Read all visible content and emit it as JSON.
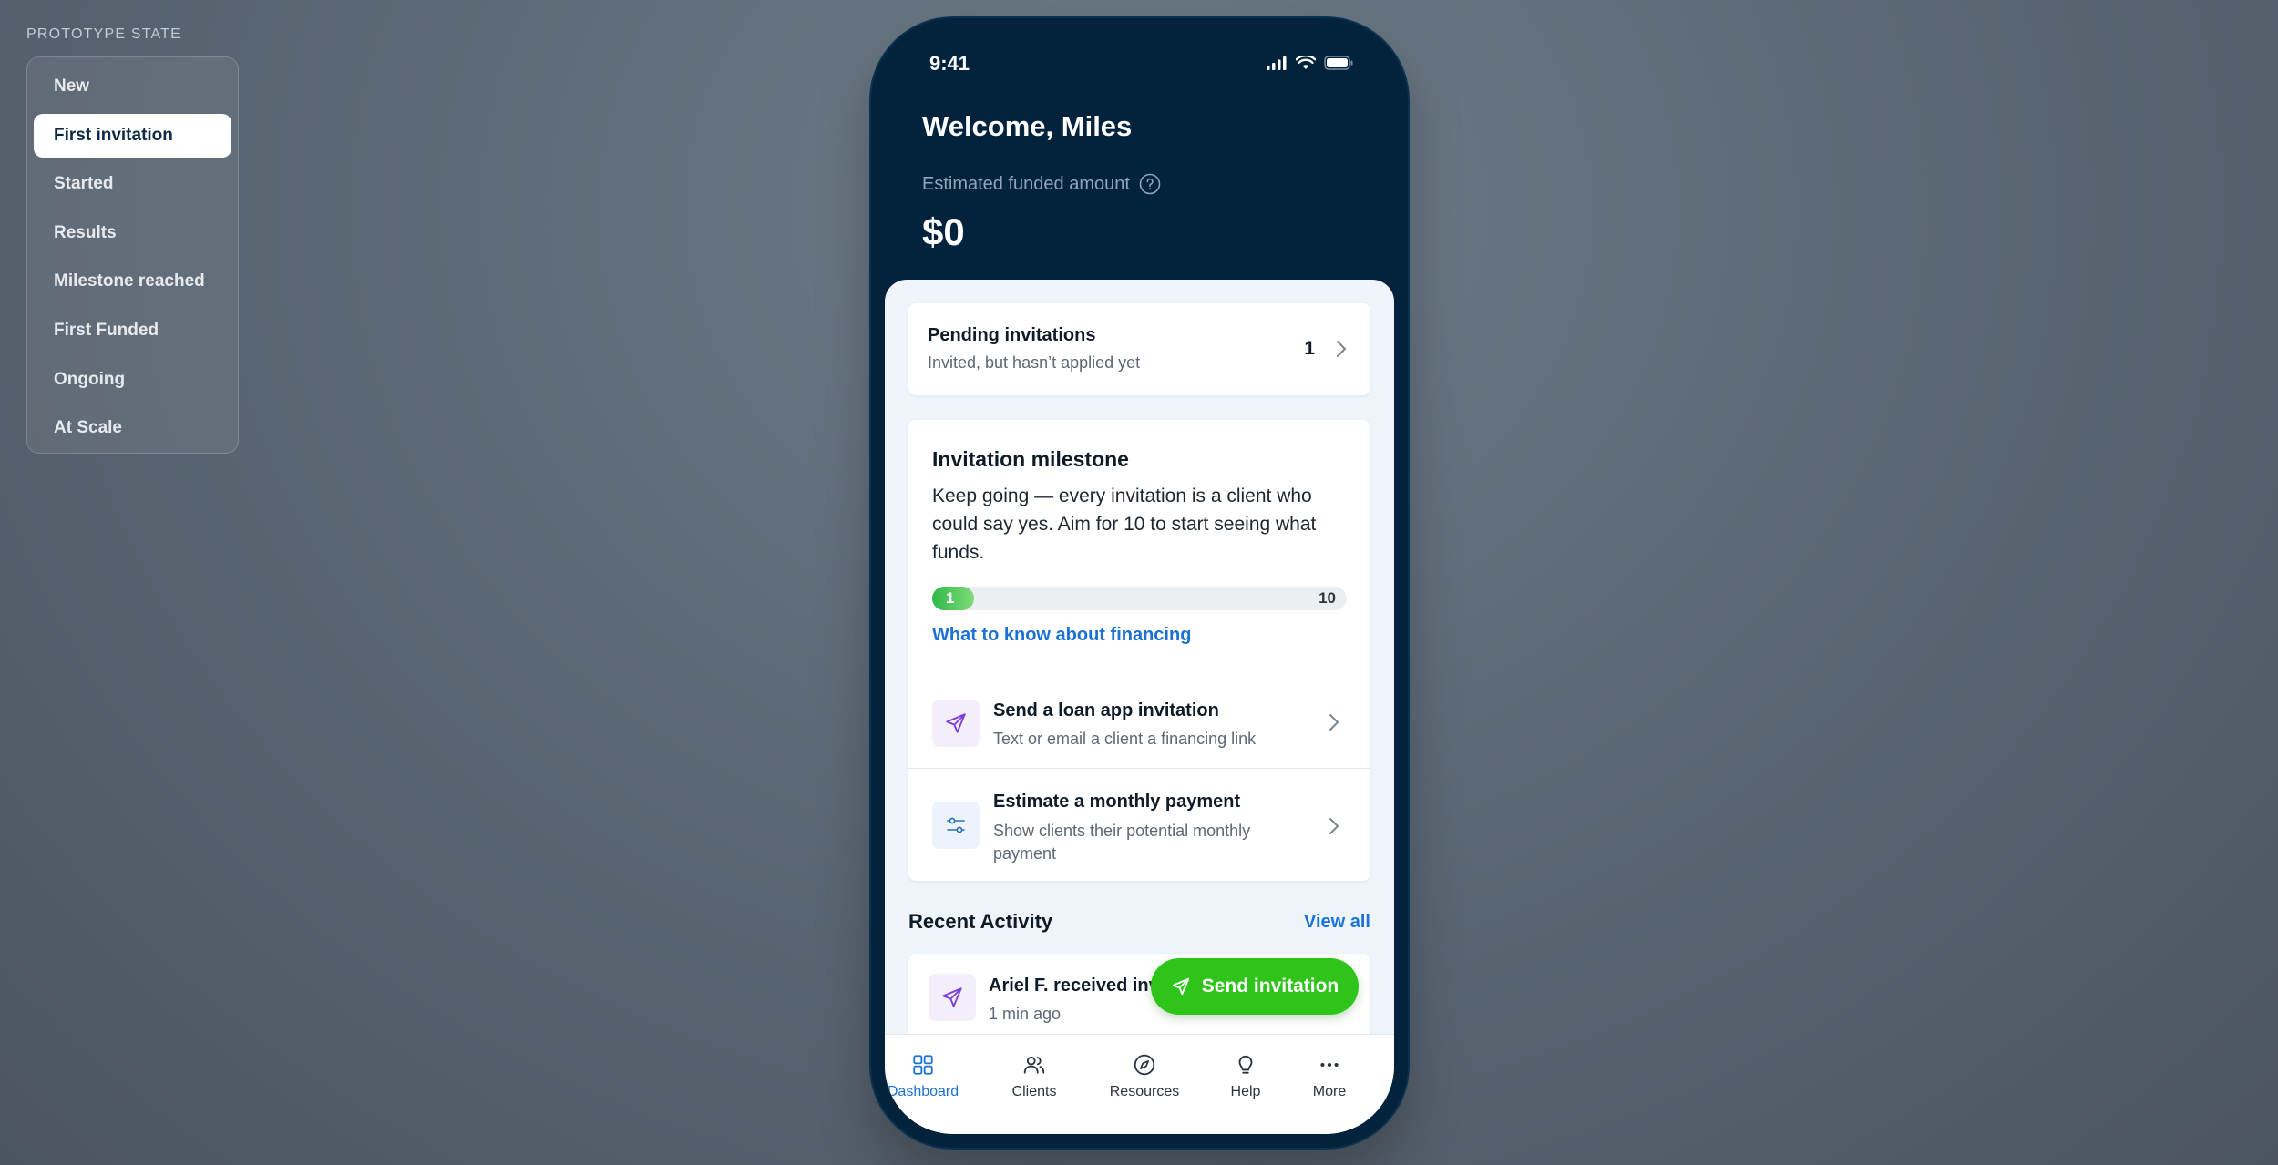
{
  "prototype": {
    "label": "PROTOTYPE STATE",
    "states": [
      "New",
      "First invitation",
      "Started",
      "Results",
      "Milestone reached",
      "First Funded",
      "Ongoing",
      "At Scale"
    ],
    "active": "First invitation"
  },
  "status_bar": {
    "time": "9:41"
  },
  "header": {
    "welcome": "Welcome, Miles",
    "funded_label": "Estimated funded amount",
    "funded_amount": "$0"
  },
  "pending": {
    "title": "Pending invitations",
    "subtitle": "Invited, but hasn’t applied yet",
    "count": "1"
  },
  "milestone": {
    "title": "Invitation milestone",
    "text": "Keep going — every invitation is a client who could say yes. Aim for 10 to start seeing what funds.",
    "progress_current": "1",
    "progress_max": "10",
    "progress_fraction": 0.1,
    "link": "What to know about financing"
  },
  "actions": [
    {
      "title": "Send a loan app invitation",
      "subtitle": "Text or email a client a financing link",
      "icon": "send-icon"
    },
    {
      "title": "Estimate a monthly payment",
      "subtitle": "Show clients their potential monthly payment",
      "icon": "sliders-icon"
    }
  ],
  "recent": {
    "title": "Recent Activity",
    "view_all": "View all",
    "items": [
      {
        "title": "Ariel F.  received invitation",
        "time": "1 min ago",
        "icon": "send-icon"
      }
    ]
  },
  "fab": {
    "label": "Send invitation",
    "icon": "send-icon"
  },
  "nav": {
    "items": [
      {
        "label": "Dashboard",
        "icon": "grid-icon",
        "active": true
      },
      {
        "label": "Clients",
        "icon": "users-icon",
        "active": false
      },
      {
        "label": "Resources",
        "icon": "compass-icon",
        "active": false
      },
      {
        "label": "Help",
        "icon": "lightbulb-icon",
        "active": false
      },
      {
        "label": "More",
        "icon": "more-icon",
        "active": false
      }
    ]
  },
  "colors": {
    "header_bg": "#03223c",
    "sheet_bg": "#eef4fa",
    "accent_blue": "#1a72d6",
    "accent_green": "#2ec41a",
    "progress_green": "#2fb84a",
    "send_icon_purple": "#7a3fd6"
  }
}
